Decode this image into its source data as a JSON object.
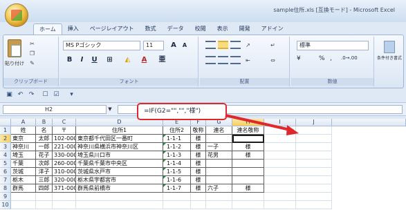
{
  "window": {
    "title": "sample住所.xls [互換モード] - Microsoft Excel"
  },
  "office_button": {
    "icon": "office-logo-icon"
  },
  "tabs": [
    "ホーム",
    "挿入",
    "ページレイアウト",
    "数式",
    "データ",
    "校閲",
    "表示",
    "開発",
    "アドイン"
  ],
  "active_tab": "ホーム",
  "ribbon": {
    "clipboard": {
      "paste_label": "貼り付け",
      "group_label": "クリップボード"
    },
    "font": {
      "font_name": "MS Pゴシック",
      "font_size": "11",
      "bold": "B",
      "italic": "I",
      "underline": "U",
      "grow": "A",
      "shrink": "A",
      "font_color_letter": "A",
      "group_label": "フォント"
    },
    "alignment": {
      "group_label": "配置"
    },
    "number": {
      "format": "標準",
      "percent": "%",
      "comma": ",",
      "group_label": "数値"
    },
    "styles": {
      "cond_format_label": "条件付き書式"
    }
  },
  "formula_bar": {
    "name_box": "H2",
    "formula": "=IF(G2=\"\",\"\",\"様\")"
  },
  "columns": [
    "A",
    "B",
    "C",
    "D",
    "E",
    "F",
    "G",
    "H",
    "I",
    "J"
  ],
  "selected_column": "H",
  "selected_row": "2",
  "rows": [
    "1",
    "2",
    "3",
    "4",
    "5",
    "6",
    "7",
    "8",
    "9",
    "10"
  ],
  "table": {
    "headers": [
      "姓",
      "名",
      "〒",
      "住所1",
      "住所2",
      "敬称",
      "連名",
      "連名敬称"
    ],
    "data": [
      [
        "東京",
        "太郎",
        "102-0000",
        "東京都千代田区一番町",
        "1-1-1",
        "様",
        "",
        ""
      ],
      [
        "神奈川",
        "一郎",
        "221-0000",
        "神奈川県横浜市神奈川区",
        "1-1-2",
        "様",
        "一子",
        "様"
      ],
      [
        "埼玉",
        "花子",
        "330-0000",
        "埼玉県川口市",
        "1-1-3",
        "様",
        "花男",
        "様"
      ],
      [
        "千葉",
        "次郎",
        "260-0000",
        "千葉県千葉市中央区",
        "1-1-4",
        "様",
        "",
        ""
      ],
      [
        "茨城",
        "洋子",
        "310-0000",
        "茨城県水戸市",
        "1-1-5",
        "様",
        "",
        ""
      ],
      [
        "栃木",
        "三郎",
        "320-0000",
        "栃木県宇都宮市",
        "1-1-6",
        "様",
        "",
        ""
      ],
      [
        "群馬",
        "四郎",
        "371-0000",
        "群馬県前橋市",
        "1-1-7",
        "様",
        "六子",
        "様"
      ]
    ]
  },
  "annotation": {
    "arrow_color": "#e0282c",
    "box_color": "#e0282c"
  }
}
